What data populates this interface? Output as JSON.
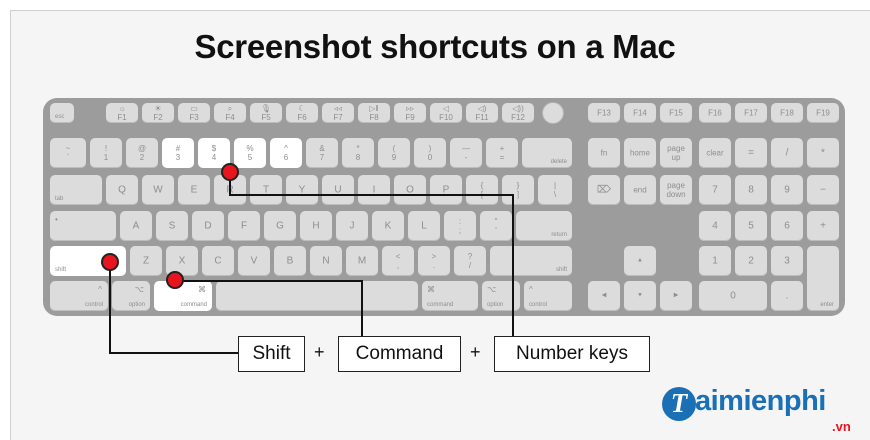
{
  "title": "Screenshot shortcuts on a Mac",
  "labels": {
    "shift": "Shift",
    "plus1": "+",
    "command": "Command",
    "plus2": "+",
    "number_keys": "Number keys"
  },
  "logo": {
    "initial": "T",
    "word": "aimienphi",
    "tld": ".vn"
  },
  "keys": {
    "esc": "esc",
    "f1": "☼\nF1",
    "f2": "☀\nF2",
    "f3": "▭\nF3",
    "f4": "⌕\nF4",
    "f5": "🎙\nF5",
    "f6": "☾\nF6",
    "f7": "◃◃\nF7",
    "f8": "▷‖\nF8",
    "f9": "▹▹\nF9",
    "f10": "◁\nF10",
    "f11": "◁)\nF11",
    "f12": "◁))\nF12",
    "f13": "F13",
    "f14": "F14",
    "f15": "F15",
    "f16": "F16",
    "f17": "F17",
    "f18": "F18",
    "f19": "F19",
    "tilde": "~\n`",
    "n1": "!\n1",
    "n2": "@\n2",
    "n3": "#\n3",
    "n4": "$\n4",
    "n5": "%\n5",
    "n6": "^\n6",
    "n7": "&\n7",
    "n8": "*\n8",
    "n9": "(\n9",
    "n0": ")\n0",
    "minus": "—\n-",
    "equals": "+\n=",
    "delete": "delete",
    "fn": "fn",
    "home": "home",
    "pageup": "page\nup",
    "clear": "clear",
    "kp_eq": "=",
    "kp_div": "/",
    "kp_mul": "*",
    "tab": "tab",
    "q": "Q",
    "w": "W",
    "e": "E",
    "r": "R",
    "t": "T",
    "y": "Y",
    "u": "U",
    "i": "I",
    "o": "O",
    "p": "P",
    "lbr": "{\n[",
    "rbr": "}\n]",
    "bslash": "|\n\\",
    "fwd_delete": "⌦",
    "end": "end",
    "pagedown": "page\ndown",
    "kp7": "7",
    "kp8": "8",
    "kp9": "9",
    "kp_minus": "−",
    "caps": "•",
    "a": "A",
    "s": "S",
    "d": "D",
    "f": "F",
    "g": "G",
    "h": "H",
    "j": "J",
    "k": "K",
    "l": "L",
    "semi": ":\n;",
    "quote": "\"\n'",
    "return": "return",
    "kp4": "4",
    "kp5": "5",
    "kp6": "6",
    "kp_plus": "+",
    "lshift": "shift",
    "z": "Z",
    "x": "X",
    "c": "C",
    "v": "V",
    "b": "B",
    "n": "N",
    "m": "M",
    "comma": "<\n,",
    "period": ">\n.",
    "slash": "?\n/",
    "rshift": "shift",
    "up": "▲",
    "kp1": "1",
    "kp2": "2",
    "kp3": "3",
    "lcontrol": "control",
    "lcontrol_sym": "^",
    "loption": "option",
    "loption_sym": "⌥",
    "lcommand": "command",
    "lcommand_sym": "⌘",
    "space": "",
    "rcommand": "command",
    "rcommand_sym": "⌘",
    "roption": "option",
    "roption_sym": "⌥",
    "rcontrol": "control",
    "rcontrol_sym": "^",
    "left": "◀",
    "down": "▼",
    "right": "▶",
    "kp0": "0",
    "kp_dot": ".",
    "enter": "enter"
  }
}
